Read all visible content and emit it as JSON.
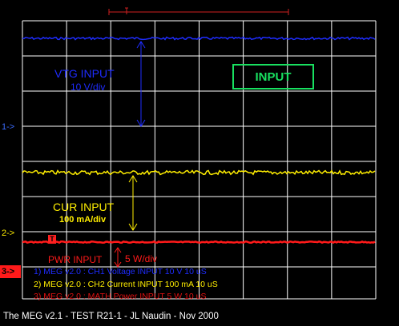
{
  "scope": {
    "title_box_label": "INPUT",
    "vtg": {
      "label": "VTG INPUT",
      "scale": "10 V/div"
    },
    "cur": {
      "label": "CUR INPUT",
      "scale": "100 mA/div"
    },
    "pwr": {
      "label": "PWR INPUT",
      "scale": "5 W/div"
    },
    "channel_markers": {
      "ch1": "1->",
      "ch2": "2->",
      "ch3": "3->"
    },
    "trigger_marker": "T",
    "legend": [
      "1) MEG v2.0 : CH1 Voltage INPUT 10  V 10 uS",
      "2) MEG v2.0 : CH2 Current INPUT 100 mA 10 uS",
      "3) MEG v2.0 : MATH Power INPUT 5  W 10 uS"
    ],
    "footer": "The MEG v2.1 - TEST R21-1 - JL Naudin - Nov 2000"
  },
  "colors": {
    "grid": "#ffffff",
    "ch1": "#1e2cff",
    "ch2": "#ffee00",
    "ch3": "#ff1a1a",
    "title_box": "#18e060",
    "background": "#000000"
  }
}
